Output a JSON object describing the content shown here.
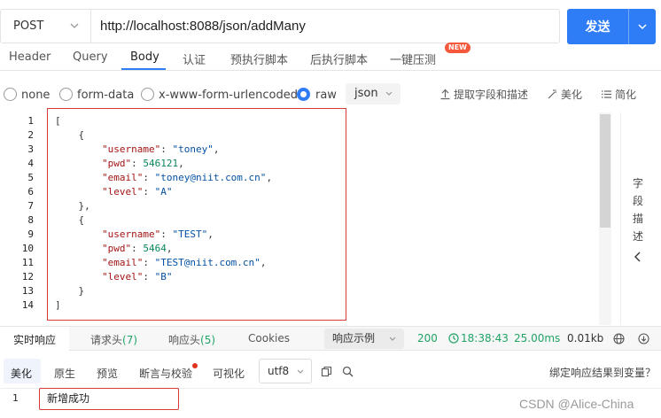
{
  "request": {
    "method": "POST",
    "url": "http://localhost:8088/json/addMany",
    "send_label": "发送"
  },
  "tabs": [
    {
      "label": "Header"
    },
    {
      "label": "Query"
    },
    {
      "label": "Body",
      "active": true
    },
    {
      "label": "认证"
    },
    {
      "label": "预执行脚本"
    },
    {
      "label": "后执行脚本"
    },
    {
      "label": "一键压测",
      "badge": "NEW"
    }
  ],
  "body_options": {
    "radios": [
      {
        "label": "none",
        "checked": false
      },
      {
        "label": "form-data",
        "checked": false
      },
      {
        "label": "x-www-form-urlencoded",
        "checked": false
      },
      {
        "label": "raw",
        "checked": true
      }
    ],
    "format": "json",
    "tools": {
      "extract": "提取字段和描述",
      "beautify": "美化",
      "simplify": "简化"
    }
  },
  "editor": {
    "line_numbers": [
      "1",
      "2",
      "3",
      "4",
      "5",
      "6",
      "7",
      "8",
      "9",
      "10",
      "11",
      "12",
      "13",
      "14"
    ],
    "lines": [
      [
        {
          "t": "p",
          "v": "["
        }
      ],
      [
        {
          "t": "p",
          "v": "    {"
        }
      ],
      [
        {
          "t": "p",
          "v": "        "
        },
        {
          "t": "k",
          "v": "\"username\""
        },
        {
          "t": "p",
          "v": ": "
        },
        {
          "t": "s",
          "v": "\"toney\""
        },
        {
          "t": "p",
          "v": ","
        }
      ],
      [
        {
          "t": "p",
          "v": "        "
        },
        {
          "t": "k",
          "v": "\"pwd\""
        },
        {
          "t": "p",
          "v": ": "
        },
        {
          "t": "n",
          "v": "546121"
        },
        {
          "t": "p",
          "v": ","
        }
      ],
      [
        {
          "t": "p",
          "v": "        "
        },
        {
          "t": "k",
          "v": "\"email\""
        },
        {
          "t": "p",
          "v": ": "
        },
        {
          "t": "s",
          "v": "\"toney@niit.com.cn\""
        },
        {
          "t": "p",
          "v": ","
        }
      ],
      [
        {
          "t": "p",
          "v": "        "
        },
        {
          "t": "k",
          "v": "\"level\""
        },
        {
          "t": "p",
          "v": ": "
        },
        {
          "t": "s",
          "v": "\"A\""
        }
      ],
      [
        {
          "t": "p",
          "v": "    },"
        }
      ],
      [
        {
          "t": "p",
          "v": "    {"
        }
      ],
      [
        {
          "t": "p",
          "v": "        "
        },
        {
          "t": "k",
          "v": "\"username\""
        },
        {
          "t": "p",
          "v": ": "
        },
        {
          "t": "s",
          "v": "\"TEST\""
        },
        {
          "t": "p",
          "v": ","
        }
      ],
      [
        {
          "t": "p",
          "v": "        "
        },
        {
          "t": "k",
          "v": "\"pwd\""
        },
        {
          "t": "p",
          "v": ": "
        },
        {
          "t": "n",
          "v": "5464"
        },
        {
          "t": "p",
          "v": ","
        }
      ],
      [
        {
          "t": "p",
          "v": "        "
        },
        {
          "t": "k",
          "v": "\"email\""
        },
        {
          "t": "p",
          "v": ": "
        },
        {
          "t": "s",
          "v": "\"TEST@niit.com.cn\""
        },
        {
          "t": "p",
          "v": ","
        }
      ],
      [
        {
          "t": "p",
          "v": "        "
        },
        {
          "t": "k",
          "v": "\"level\""
        },
        {
          "t": "p",
          "v": ": "
        },
        {
          "t": "s",
          "v": "\"B\""
        }
      ],
      [
        {
          "t": "p",
          "v": "    }"
        }
      ],
      [
        {
          "t": "p",
          "v": "]"
        }
      ]
    ],
    "side_panel_label": "字段描述"
  },
  "response_tabs": {
    "realtime": "实时响应",
    "req_headers": "请求头",
    "req_headers_count": "(7)",
    "resp_headers": "响应头",
    "resp_headers_count": "(5)",
    "cookies": "Cookies",
    "example": "响应示例"
  },
  "status": {
    "code": "200",
    "time": "18:38:43",
    "duration": "25.00ms",
    "size": "0.01kb"
  },
  "response_tools": {
    "beautify": "美化",
    "raw": "原生",
    "preview": "预览",
    "assert": "断言与校验",
    "visualize": "可视化",
    "encoding": "utf8",
    "bind": "绑定响应结果到变量？"
  },
  "response_body": {
    "line": "1",
    "text": "新增成功"
  },
  "watermark": "CSDN @Alice-China",
  "colors": {
    "accent": "#2f7df6",
    "highlight_box": "#d93a3a",
    "success": "#21a366"
  }
}
